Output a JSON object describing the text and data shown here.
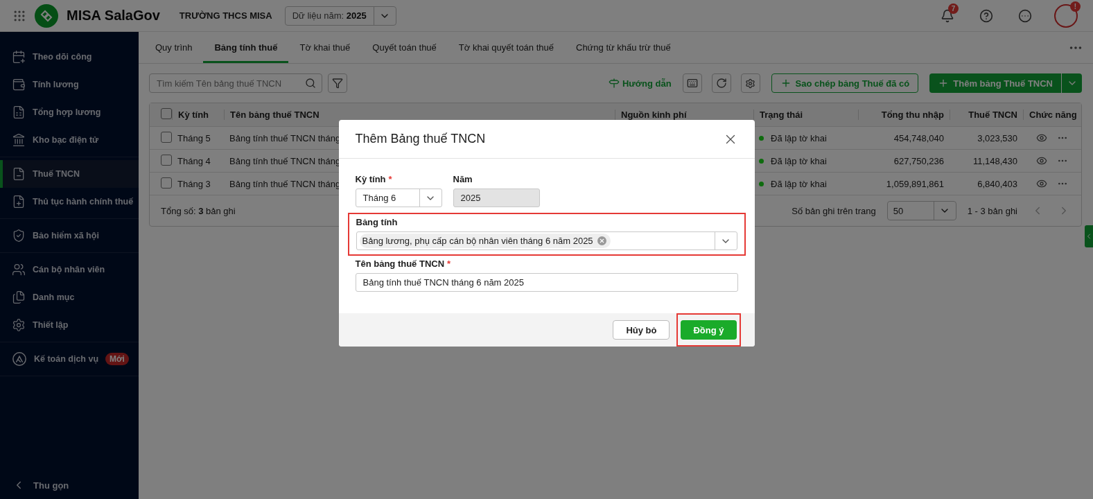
{
  "topbar": {
    "app_name": "MISA SalaGov",
    "org": "TRƯỜNG THCS MISA",
    "year_label": "Dữ liệu năm:",
    "year_value": "2025",
    "notification_count": "7",
    "avatar_badge": "!"
  },
  "sidebar": {
    "groups": [
      {
        "items": [
          {
            "label": "Theo dõi công",
            "selected": false
          },
          {
            "label": "Tính lương",
            "selected": false
          },
          {
            "label": "Tổng hợp lương",
            "selected": false
          },
          {
            "label": "Kho bạc điện tử",
            "selected": false
          }
        ]
      },
      {
        "items": [
          {
            "label": "Thuế TNCN",
            "selected": true
          },
          {
            "label": "Thủ tục hành chính thuế",
            "selected": false
          }
        ]
      },
      {
        "items": [
          {
            "label": "Bảo hiểm xã hội",
            "selected": false
          }
        ]
      },
      {
        "items": [
          {
            "label": "Cán bộ nhân viên",
            "selected": false
          },
          {
            "label": "Danh mục",
            "selected": false
          },
          {
            "label": "Thiết lập",
            "selected": false
          }
        ]
      },
      {
        "items": [
          {
            "label": "Kế toán dịch vụ",
            "selected": false,
            "badge": "Mới"
          }
        ]
      }
    ],
    "collapse_label": "Thu gọn"
  },
  "tabs": [
    {
      "label": "Quy trình",
      "selected": false
    },
    {
      "label": "Bảng tính thuế",
      "selected": true
    },
    {
      "label": "Tờ khai thuế",
      "selected": false
    },
    {
      "label": "Quyết toán thuế",
      "selected": false
    },
    {
      "label": "Tờ khai quyết toán thuế",
      "selected": false
    },
    {
      "label": "Chứng từ khấu trừ thuế",
      "selected": false
    }
  ],
  "toolbar": {
    "search_placeholder": "Tìm kiếm Tên bảng thuế TNCN",
    "guide_label": "Hướng dẫn",
    "copy_button": "Sao chép bảng Thuế đã có",
    "add_button": "Thêm bảng Thuế TNCN"
  },
  "table": {
    "columns": [
      "Kỳ tính",
      "Tên bảng thuế TNCN",
      "Nguồn kinh phí",
      "Trạng thái",
      "Tổng thu nhập",
      "Thuế TNCN",
      "Chức năng"
    ],
    "header_checked": false,
    "rows": [
      {
        "checked": false,
        "period": "Tháng 5",
        "name": "Bảng tính thuế TNCN tháng",
        "status": "Đã lập tờ khai",
        "color": "#0e6b0e",
        "income": "454,748,040",
        "tax": "3,023,530"
      },
      {
        "checked": false,
        "period": "Tháng 4",
        "name": "Bảng tính thuế TNCN tháng",
        "status": "Đã lập tờ khai",
        "color": "#0e6b0e",
        "income": "627,750,236",
        "tax": "11,148,430"
      },
      {
        "checked": false,
        "period": "Tháng 3",
        "name": "Bảng tính thuế TNCN tháng",
        "status": "Đã lập tờ khai",
        "color": "#0e6b0e",
        "income": "1,059,891,861",
        "tax": "6,840,403"
      }
    ],
    "total": "Tổng số: **3** bản ghi",
    "page_size_label": "Số bản ghi trên trang",
    "page_size": "50",
    "range": "1 - 3 bản ghi"
  },
  "modal": {
    "title": "Thêm Bảng thuế TNCN",
    "period": {
      "label": "Kỳ tính",
      "required_mark": "*",
      "value": "Tháng 6"
    },
    "year": {
      "label": "Năm",
      "value": "2025",
      "disabled": true
    },
    "source": {
      "label": "Bảng tính",
      "tags": [
        "Bảng lương, phụ cấp cán bộ nhân viên tháng 6 năm 2025"
      ],
      "highlighted": true
    },
    "name_field": {
      "label": "Tên bảng thuế TNCN",
      "required_mark": "*",
      "value": "Bảng tính thuế TNCN tháng 6 năm 2025"
    },
    "buttons": [
      {
        "label": "Hủy bỏ",
        "kind": "secondary",
        "highlighted": false
      },
      {
        "label": "Đồng ý",
        "kind": "primary",
        "highlighted": true
      }
    ]
  }
}
